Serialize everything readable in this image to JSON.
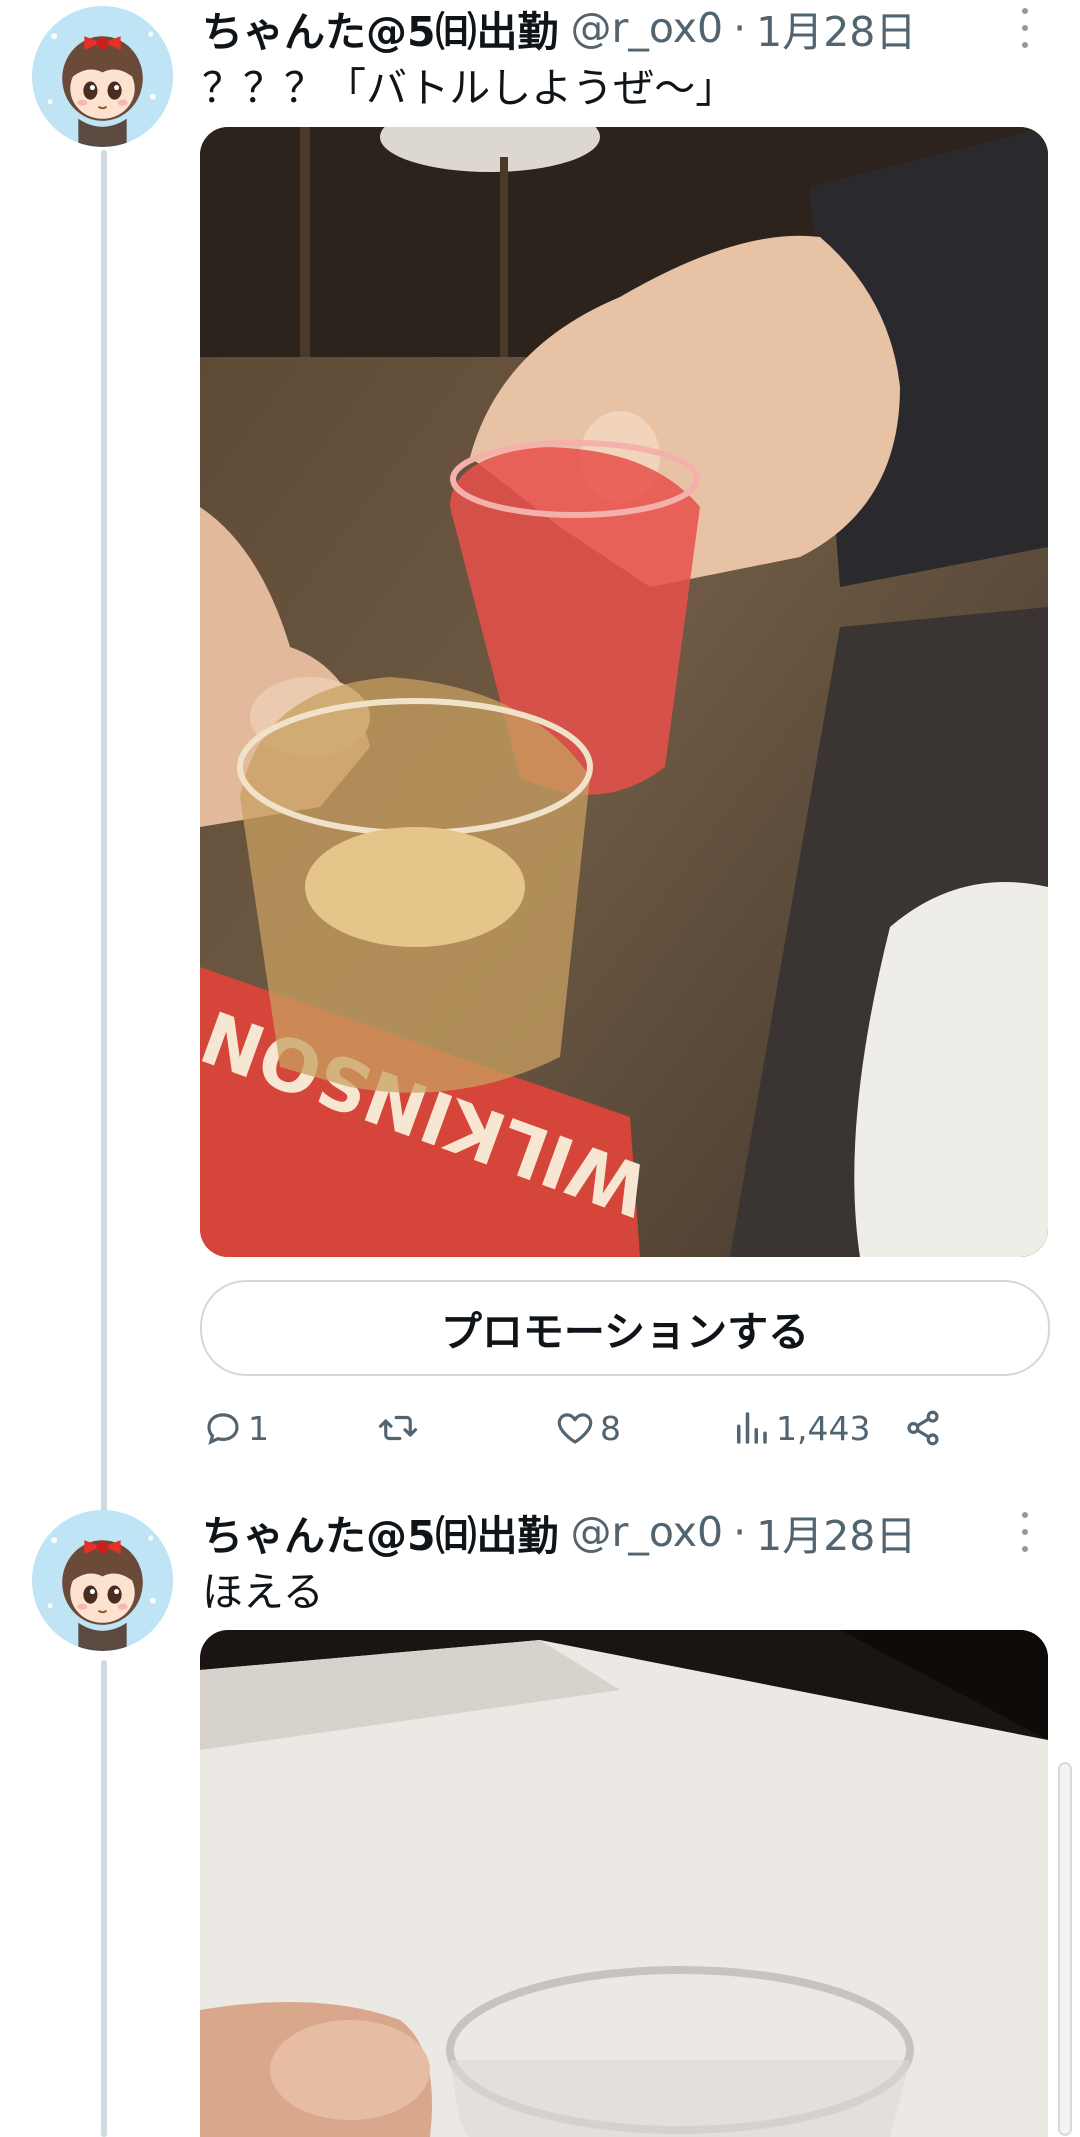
{
  "tweets": [
    {
      "author_name": "ちゃんた@5㈰出勤",
      "handle": "@r_ox0",
      "separator": "·",
      "date": "1月28日",
      "text": "？？？「バトルしようぜ〜」",
      "avatar_label": "ちゃんた",
      "media_label": "WILKINSON",
      "promote_label": "プロモーションする",
      "reply_count": "1",
      "retweet_count": "",
      "like_count": "8",
      "view_count": "1,443"
    },
    {
      "author_name": "ちゃんた@5㈰出勤",
      "handle": "@r_ox0",
      "separator": "·",
      "date": "1月28日",
      "text": "ほえる",
      "avatar_label": "ちゃんた"
    }
  ],
  "icons": {
    "reply": "reply-icon",
    "retweet": "retweet-icon",
    "like": "heart-icon",
    "views": "analytics-icon",
    "share": "share-icon",
    "more": "more-options-icon"
  },
  "colors": {
    "text": "#0f1419",
    "secondary": "#536471",
    "thread_line": "#cfd9de",
    "avatar_bg": "#bfe4f5"
  }
}
